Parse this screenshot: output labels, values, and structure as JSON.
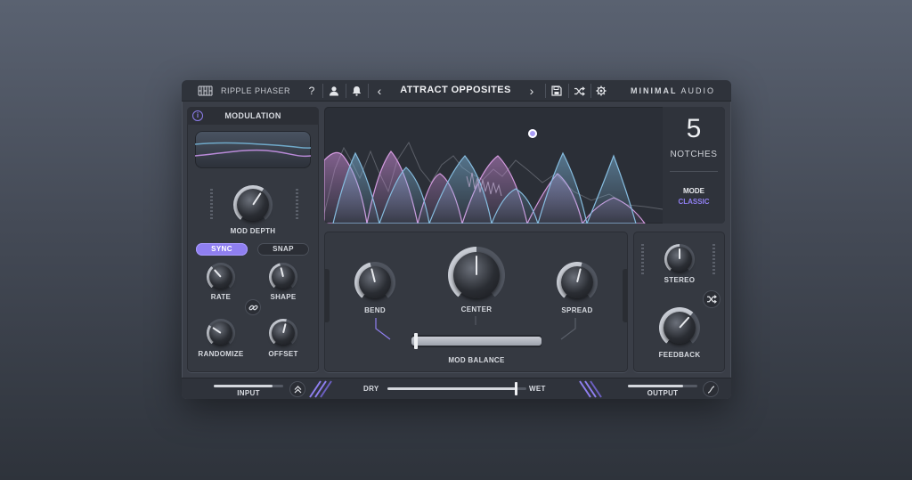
{
  "header": {
    "product_name": "RIPPLE PHASER",
    "preset_name": "ATTRACT OPPOSITES",
    "brand_left": "MINIMAL",
    "brand_right": "AUDIO",
    "help": "?",
    "prev": "‹",
    "next": "›"
  },
  "modulation": {
    "title": "MODULATION",
    "info": "i",
    "mod_depth_label": "MOD DEPTH",
    "sync_label": "SYNC",
    "snap_label": "SNAP",
    "rate_label": "RATE",
    "shape_label": "SHAPE",
    "randomize_label": "RANDOMIZE",
    "offset_label": "OFFSET",
    "sync_active": true,
    "knobs": {
      "mod_depth": 0.62,
      "rate": 0.35,
      "shape": 0.45,
      "randomize": 0.3,
      "offset": 0.55
    }
  },
  "display": {
    "notches_value": "5",
    "notches_label": "NOTCHES",
    "mode_label": "MODE",
    "mode_value": "CLASSIC"
  },
  "main": {
    "bend_label": "BEND",
    "center_label": "CENTER",
    "spread_label": "SPREAD",
    "mod_balance_label": "MOD BALANCE",
    "knobs": {
      "bend": 0.45,
      "center": 0.5,
      "spread": 0.55
    },
    "mod_balance": 0.02
  },
  "right": {
    "stereo_label": "STEREO",
    "feedback_label": "FEEDBACK",
    "knobs": {
      "stereo": 0.5,
      "feedback": 0.65
    }
  },
  "footer": {
    "input_label": "INPUT",
    "output_label": "OUTPUT",
    "dry_label": "DRY",
    "wet_label": "WET",
    "input_level": 0.85,
    "output_level": 0.8,
    "dry_wet": 0.92
  },
  "colors": {
    "accent": "#8f7ff0",
    "pink": "#c98ad6",
    "blue": "#7ab0d4"
  },
  "icons": {
    "user": "user-icon",
    "bell": "bell-icon",
    "save": "save-icon",
    "shuffle": "shuffle-icon",
    "settings": "gear-icon",
    "link": "link-icon"
  }
}
